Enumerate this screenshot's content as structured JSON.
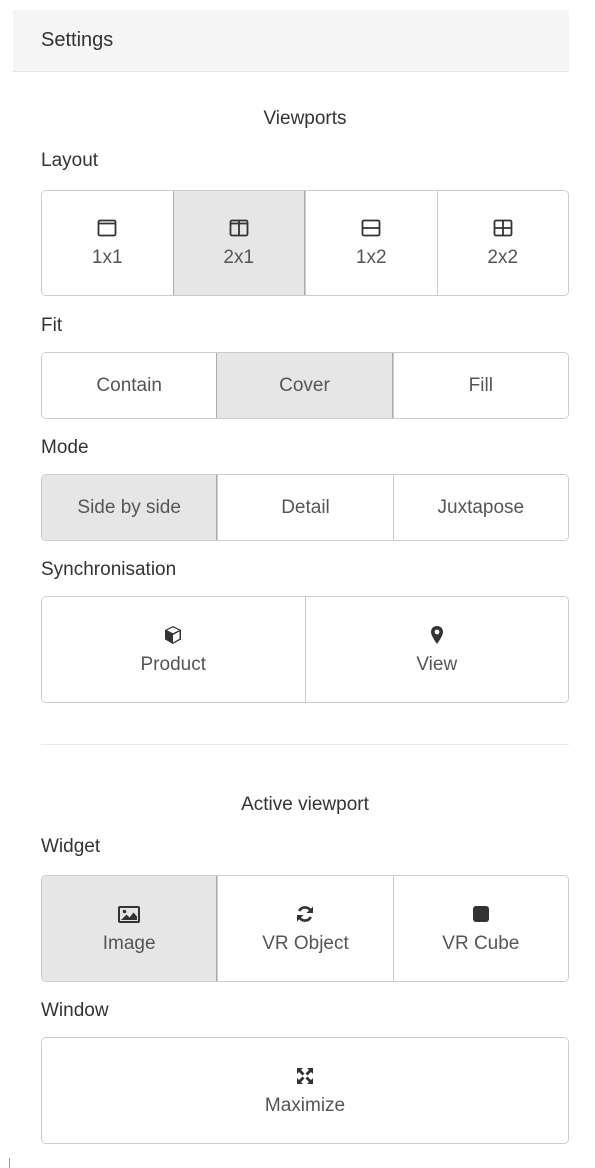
{
  "header": {
    "title": "Settings"
  },
  "viewports": {
    "title": "Viewports",
    "layout": {
      "label": "Layout",
      "options": [
        {
          "label": "1x1",
          "icon": "single-square-icon"
        },
        {
          "label": "2x1",
          "icon": "columns-icon",
          "active": true
        },
        {
          "label": "1x2",
          "icon": "rows-icon"
        },
        {
          "label": "2x2",
          "icon": "grid-icon"
        }
      ]
    },
    "fit": {
      "label": "Fit",
      "options": [
        {
          "label": "Contain"
        },
        {
          "label": "Cover",
          "active": true
        },
        {
          "label": "Fill"
        }
      ]
    },
    "mode": {
      "label": "Mode",
      "options": [
        {
          "label": "Side by side",
          "active": true
        },
        {
          "label": "Detail"
        },
        {
          "label": "Juxtapose"
        }
      ]
    },
    "sync": {
      "label": "Synchronisation",
      "options": [
        {
          "label": "Product",
          "icon": "cube-icon"
        },
        {
          "label": "View",
          "icon": "map-marker-icon"
        }
      ]
    }
  },
  "active_viewport": {
    "title": "Active viewport",
    "widget": {
      "label": "Widget",
      "options": [
        {
          "label": "Image",
          "icon": "image-icon",
          "active": true
        },
        {
          "label": "VR Object",
          "icon": "refresh-icon"
        },
        {
          "label": "VR Cube",
          "icon": "square-icon"
        }
      ]
    },
    "window": {
      "label": "Window",
      "options": [
        {
          "label": "Maximize",
          "icon": "expand-icon"
        }
      ]
    }
  },
  "colors": {
    "active_bg": "#e6e6e6",
    "border": "#cccccc",
    "header_bg": "#f5f5f5",
    "text": "#333333"
  }
}
